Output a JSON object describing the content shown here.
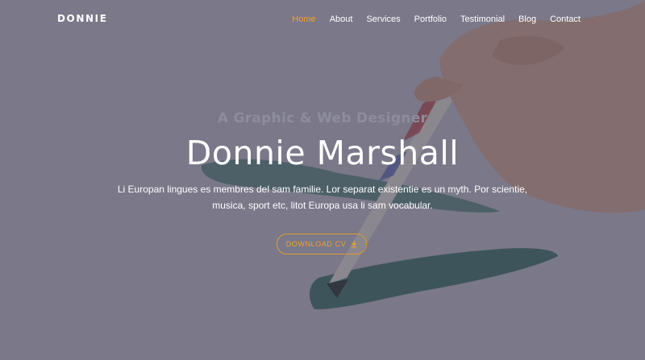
{
  "brand": {
    "name": "DONNIE"
  },
  "nav": {
    "items": [
      {
        "label": "Home",
        "active": true
      },
      {
        "label": "About",
        "active": false
      },
      {
        "label": "Services",
        "active": false
      },
      {
        "label": "Portfolio",
        "active": false
      },
      {
        "label": "Testimonial",
        "active": false
      },
      {
        "label": "Blog",
        "active": false
      },
      {
        "label": "Contact",
        "active": false
      }
    ]
  },
  "hero": {
    "subtitle": "A Graphic & Web Designer",
    "title": "Donnie Marshall",
    "description": "Li Europan lingues es membres del sam familie. Lor separat existentie es un myth. Por scientie, musica, sport etc, litot Europa usa li sam vocabular.",
    "button_label": "DOWNLOAD CV",
    "button_icon": "download-icon"
  },
  "colors": {
    "accent": "#f0a030",
    "overlay": "#343246",
    "text": "#ffffff",
    "subtitle": "#8e8d9b"
  }
}
